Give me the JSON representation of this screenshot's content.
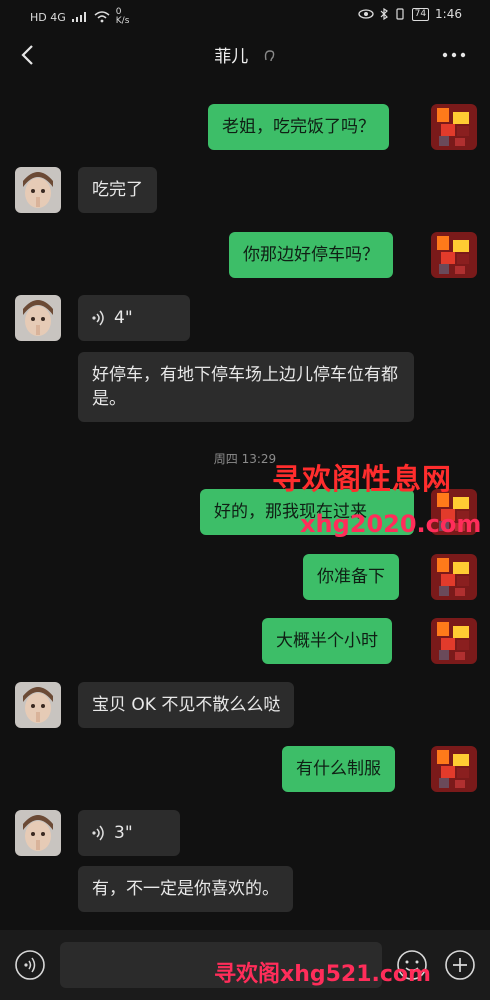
{
  "status": {
    "left_text": "HD 4G",
    "speed_value": "0",
    "speed_unit": "K/s",
    "battery": "74",
    "time": "1:46"
  },
  "header": {
    "title": "菲儿"
  },
  "messages": [
    {
      "text": "老姐，吃完饭了吗？"
    },
    {
      "text": "吃完了"
    },
    {
      "text": "你那边好停车吗？"
    },
    {
      "voice_len": "4\""
    },
    {
      "text": "好停车，有地下停车场上边儿停车位有都是。"
    },
    {
      "time": "周四 13:29"
    },
    {
      "text": "好的，那我现在过来"
    },
    {
      "text": "你准备下"
    },
    {
      "text": "大概半个小时"
    },
    {
      "text": "宝贝 OK 不见不散么么哒"
    },
    {
      "text": "有什么制服"
    },
    {
      "voice_len": "3\""
    },
    {
      "text": "有，不一定是你喜欢的。"
    }
  ],
  "watermarks": {
    "wm1": "寻欢阁性息网",
    "wm2": "xhg2020.com",
    "wm3": "寻欢阁xhg521.com"
  },
  "colors": {
    "bg": "#111111",
    "out_bubble": "#3dbe68",
    "in_bubble": "#2c2c2c"
  }
}
